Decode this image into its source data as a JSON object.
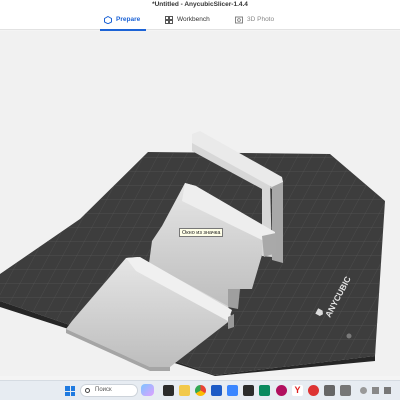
{
  "window": {
    "title": "*Untitled - AnycubicSlicer-1.4.4"
  },
  "tabs": [
    {
      "label": "Prepare",
      "icon": "prepare-icon",
      "active": true
    },
    {
      "label": "Workbench",
      "icon": "workbench-icon",
      "active": false
    },
    {
      "label": "3D Photo",
      "icon": "photo-icon",
      "active": false
    }
  ],
  "viewport": {
    "bed_brand": "ANYCUBIC",
    "tooltip": "Окно из значка"
  },
  "taskbar": {
    "search_placeholder": "Поиск",
    "icons": [
      "start-icon",
      "search-icon",
      "widgets-icon",
      "file-explorer-icon",
      "chrome-icon",
      "anycubic-icon",
      "mail-icon",
      "edge-icon",
      "yandex-icon",
      "camera-icon"
    ]
  },
  "colors": {
    "accent": "#1c63d6",
    "bed": "#3c3c3c",
    "model": "#cfcfcf"
  }
}
